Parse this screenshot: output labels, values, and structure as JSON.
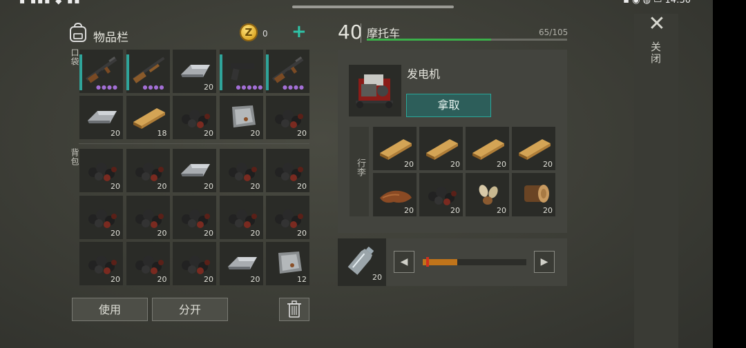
{
  "status_bar": {
    "left": "▪ ▪▪▪ ◆ ▪▪",
    "right": "▪ ◉ ◍ ▭ 14:30"
  },
  "close": {
    "icon": "close-icon",
    "label": "关闭"
  },
  "inventory": {
    "title": "物品栏",
    "coins": "0",
    "coin_symbol": "Z",
    "add": "+",
    "pocket_label": "口袋",
    "backpack_label": "背包",
    "pocket_items": [
      {
        "icon": "assault-rifle-icon",
        "count": "",
        "dots": "●●●●"
      },
      {
        "icon": "shotgun-icon",
        "count": "",
        "dots": "●●●●"
      },
      {
        "icon": "iron-bar-icon",
        "count": "20",
        "dots": ""
      },
      {
        "icon": "pistol-icon",
        "count": "",
        "dots": "●●●●●"
      },
      {
        "icon": "assault-rifle-icon",
        "count": "",
        "dots": "●●●●"
      },
      {
        "icon": "iron-bar-icon",
        "count": "20",
        "dots": ""
      },
      {
        "icon": "wood-plank-icon",
        "count": "18",
        "dots": ""
      },
      {
        "icon": "coal-icon",
        "count": "20",
        "dots": ""
      },
      {
        "icon": "metal-plate-icon",
        "count": "20",
        "dots": ""
      },
      {
        "icon": "coal-icon",
        "count": "20",
        "dots": ""
      }
    ],
    "backpack_items": [
      {
        "icon": "coal-icon",
        "count": "20"
      },
      {
        "icon": "coal-icon",
        "count": "20"
      },
      {
        "icon": "iron-bar-icon",
        "count": "20"
      },
      {
        "icon": "coal-icon",
        "count": "20"
      },
      {
        "icon": "coal-icon",
        "count": "20"
      },
      {
        "icon": "coal-icon",
        "count": "20"
      },
      {
        "icon": "coal-icon",
        "count": "20"
      },
      {
        "icon": "coal-icon",
        "count": "20"
      },
      {
        "icon": "coal-icon",
        "count": "20"
      },
      {
        "icon": "coal-icon",
        "count": "20"
      },
      {
        "icon": "coal-icon",
        "count": "20"
      },
      {
        "icon": "coal-icon",
        "count": "20"
      },
      {
        "icon": "coal-icon",
        "count": "20"
      },
      {
        "icon": "iron-bar-icon",
        "count": "20"
      },
      {
        "icon": "metal-plate-icon",
        "count": "12"
      }
    ],
    "use_label": "使用",
    "split_label": "分开"
  },
  "vehicle": {
    "level": "40",
    "name": "摩托车",
    "capacity_text": "65/105",
    "capacity_fraction": 0.619,
    "equipment_name": "发电机",
    "take_label": "拿取",
    "luggage_label": "行李",
    "luggage_items": [
      {
        "icon": "wood-plank-icon",
        "count": "20"
      },
      {
        "icon": "wood-plank-icon",
        "count": "20"
      },
      {
        "icon": "wood-plank-icon",
        "count": "20"
      },
      {
        "icon": "wood-plank-icon",
        "count": "20"
      },
      {
        "icon": "leather-icon",
        "count": "20"
      },
      {
        "icon": "coal-icon",
        "count": "20"
      },
      {
        "icon": "seeds-icon",
        "count": "20"
      },
      {
        "icon": "log-icon",
        "count": "20"
      }
    ]
  },
  "transfer": {
    "item_icon": "water-bottle-icon",
    "count": "20",
    "left_arrow": "◀",
    "right_arrow": "▶",
    "fill_fraction": 0.33
  },
  "colors": {
    "accent": "#2aa89a",
    "capacity": "#3bb04a",
    "slider": "#c0741a"
  }
}
